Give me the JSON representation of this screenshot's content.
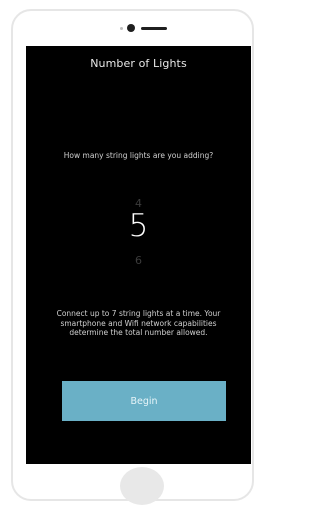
{
  "screen": {
    "title": "Number of Lights",
    "question": "How many string lights are you adding?",
    "picker": {
      "previous": "4",
      "selected": "5",
      "next": "6"
    },
    "info": "Connect up to 7 string lights at a time. Your smartphone and Wifi network capabilities determine the total number allowed.",
    "begin_label": "Begin"
  },
  "colors": {
    "screen_background": "#000000",
    "button_background": "#6ab0c6"
  }
}
